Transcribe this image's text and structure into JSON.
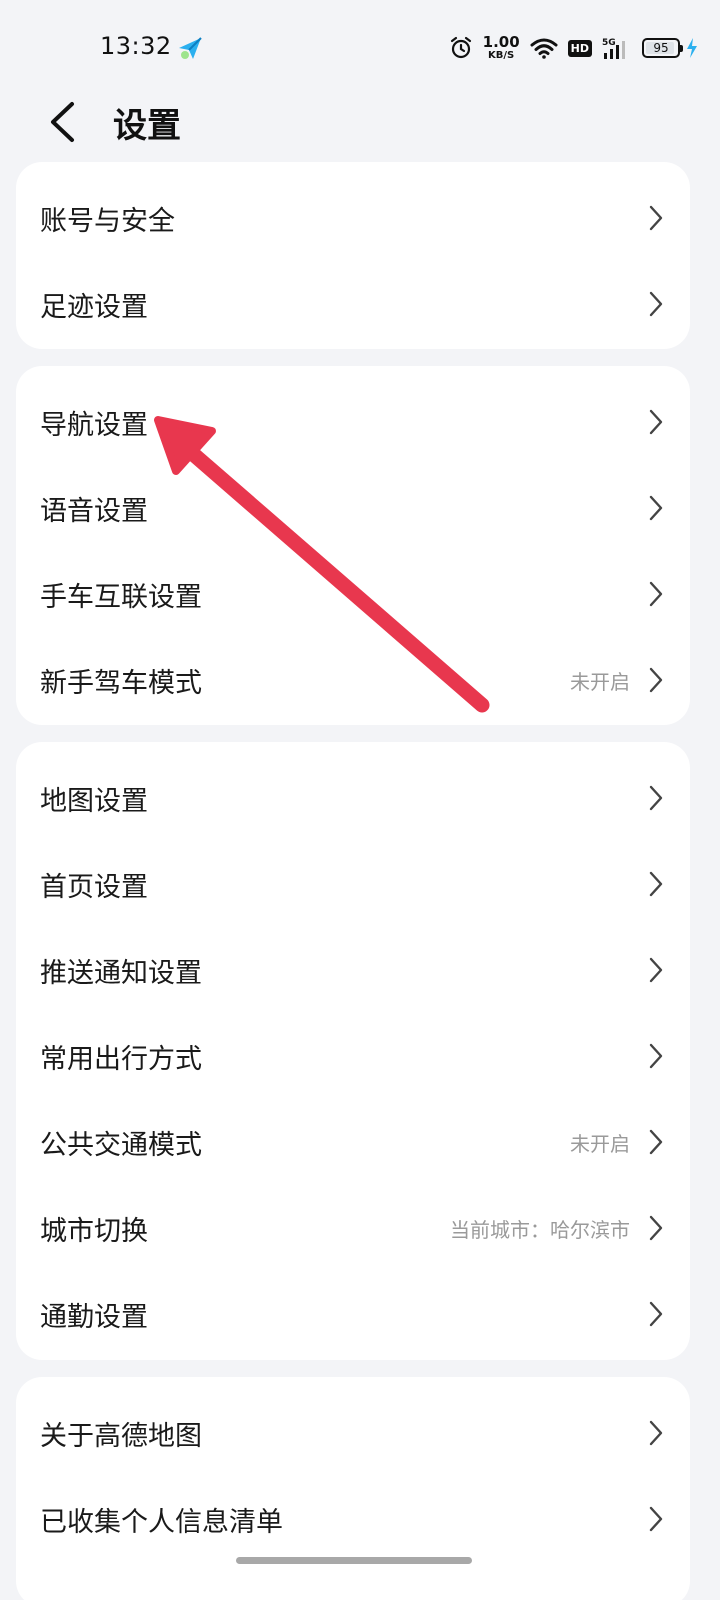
{
  "status_bar": {
    "time": "13:32",
    "app_icon": "navigation-app-icon",
    "alarm_icon": "alarm-icon",
    "net_speed": "1.00",
    "net_speed_unit": "KB/S",
    "wifi_icon": "wifi-icon",
    "hd_badge": "HD",
    "signal_label": "5G",
    "signal_icon": "signal-icon",
    "battery_level": "95",
    "charging_icon": "charging-icon"
  },
  "header": {
    "back_icon": "back-icon",
    "title": "设置"
  },
  "groups": [
    {
      "items": [
        {
          "label": "账号与安全",
          "value": ""
        },
        {
          "label": "足迹设置",
          "value": ""
        }
      ]
    },
    {
      "items": [
        {
          "label": "导航设置",
          "value": ""
        },
        {
          "label": "语音设置",
          "value": ""
        },
        {
          "label": "手车互联设置",
          "value": ""
        },
        {
          "label": "新手驾车模式",
          "value": "未开启"
        }
      ]
    },
    {
      "items": [
        {
          "label": "地图设置",
          "value": ""
        },
        {
          "label": "首页设置",
          "value": ""
        },
        {
          "label": "推送通知设置",
          "value": ""
        },
        {
          "label": "常用出行方式",
          "value": ""
        },
        {
          "label": "公共交通模式",
          "value": "未开启"
        },
        {
          "label": "城市切换",
          "value": "当前城市：哈尔滨市"
        },
        {
          "label": "通勤设置",
          "value": ""
        }
      ]
    },
    {
      "items": [
        {
          "label": "关于高德地图",
          "value": ""
        },
        {
          "label": "已收集个人信息清单",
          "value": ""
        }
      ]
    }
  ],
  "colors": {
    "background": "#f3f4f7",
    "card": "#ffffff",
    "annotation_arrow": "#e8374e",
    "secondary_text": "#9a9a9a",
    "battery_charge": "#2bb0ef"
  }
}
